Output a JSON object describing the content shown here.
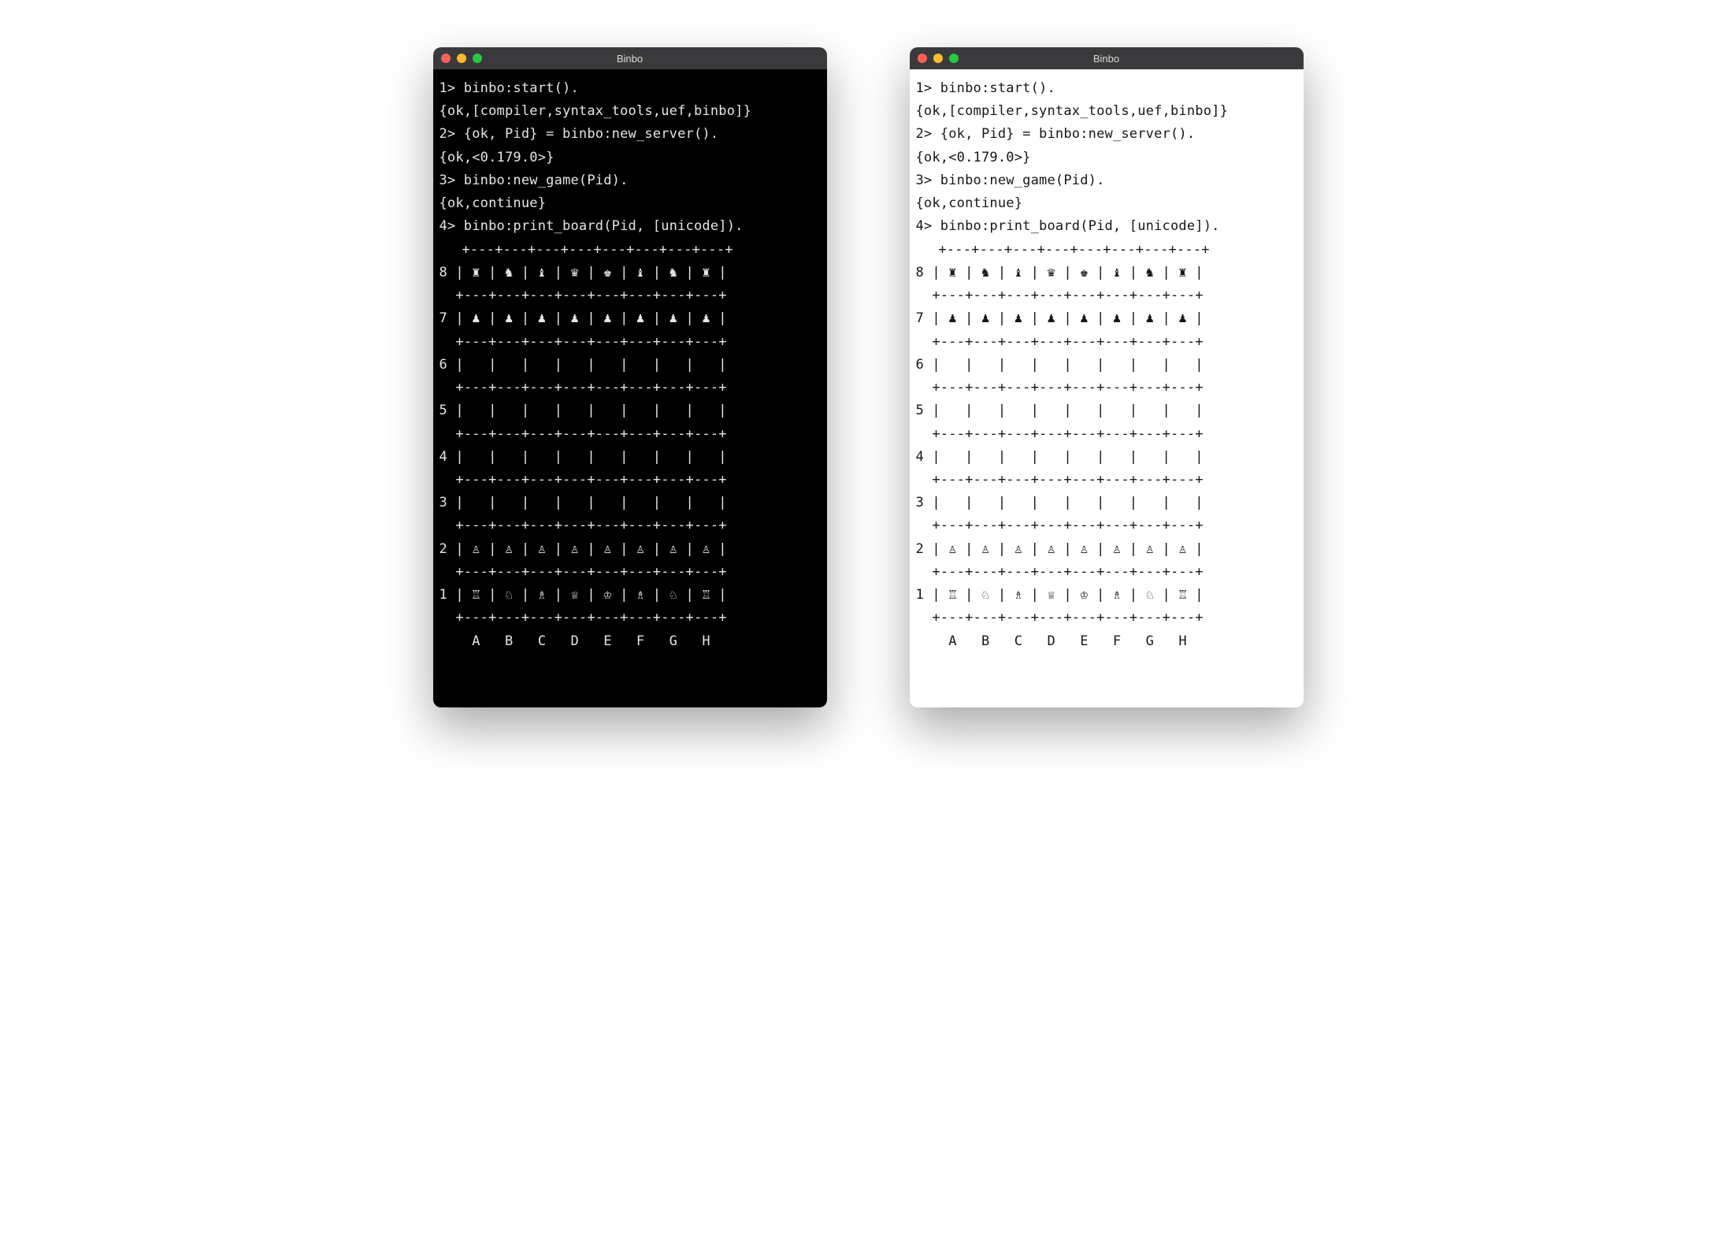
{
  "windows": {
    "dark": {
      "title": "Binbo"
    },
    "light": {
      "title": "Binbo"
    }
  },
  "session": {
    "lines": [
      "1> binbo:start().",
      "{ok,[compiler,syntax_tools,uef,binbo]}",
      "2> {ok, Pid} = binbo:new_server().",
      "{ok,<0.179.0>}",
      "3> binbo:new_game(Pid).",
      "{ok,continue}",
      "4> binbo:print_board(Pid, [unicode])."
    ]
  },
  "board": {
    "cells": {
      "8": [
        "♜",
        "♞",
        "♝",
        "♛",
        "♚",
        "♝",
        "♞",
        "♜"
      ],
      "7": [
        "♟",
        "♟",
        "♟",
        "♟",
        "♟",
        "♟",
        "♟",
        "♟"
      ],
      "6": [
        " ",
        " ",
        " ",
        " ",
        " ",
        " ",
        " ",
        " "
      ],
      "5": [
        " ",
        " ",
        " ",
        " ",
        " ",
        " ",
        " ",
        " "
      ],
      "4": [
        " ",
        " ",
        " ",
        " ",
        " ",
        " ",
        " ",
        " "
      ],
      "3": [
        " ",
        " ",
        " ",
        " ",
        " ",
        " ",
        " ",
        " "
      ],
      "2": [
        "♙",
        "♙",
        "♙",
        "♙",
        "♙",
        "♙",
        "♙",
        "♙"
      ],
      "1": [
        "♖",
        "♘",
        "♗",
        "♕",
        "♔",
        "♗",
        "♘",
        "♖"
      ]
    },
    "files": [
      "A",
      "B",
      "C",
      "D",
      "E",
      "F",
      "G",
      "H"
    ]
  }
}
